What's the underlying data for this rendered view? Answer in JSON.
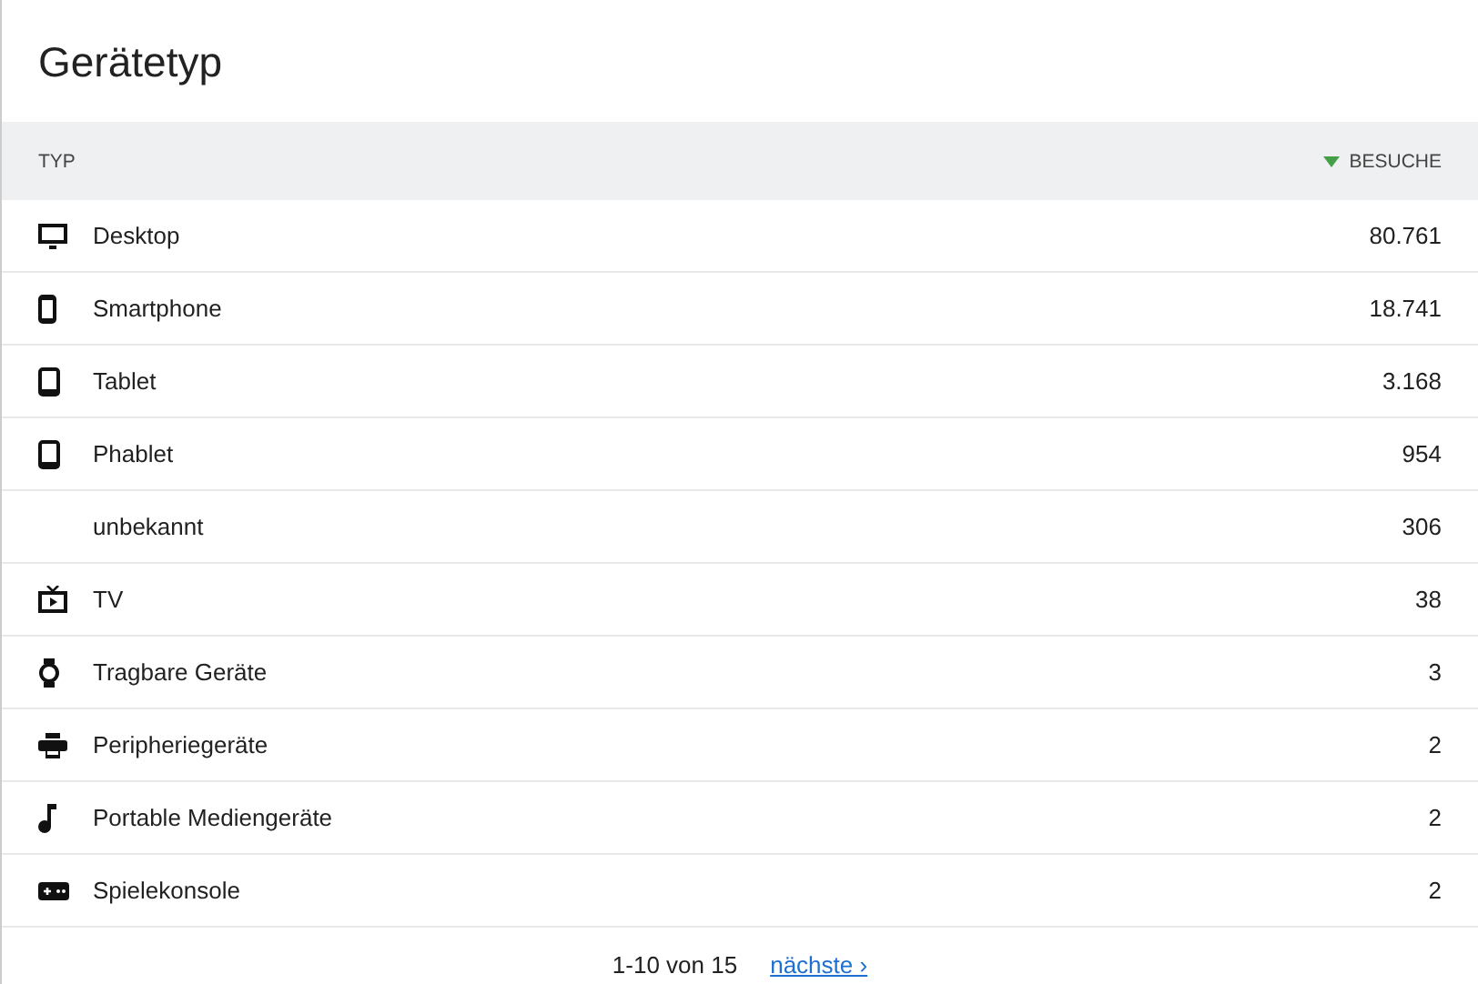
{
  "title": "Gerätetyp",
  "columns": [
    {
      "label": "TYP",
      "sorted": false
    },
    {
      "label": "BESUCHE",
      "sorted": true
    }
  ],
  "rows": [
    {
      "kind": "desktop",
      "label": "Desktop",
      "visits": "80.761"
    },
    {
      "kind": "smartphone",
      "label": "Smartphone",
      "visits": "18.741"
    },
    {
      "kind": "tablet",
      "label": "Tablet",
      "visits": "3.168"
    },
    {
      "kind": "tablet",
      "label": "Phablet",
      "visits": "954"
    },
    {
      "kind": "none",
      "label": "unbekannt",
      "visits": "306"
    },
    {
      "kind": "tv",
      "label": "TV",
      "visits": "38"
    },
    {
      "kind": "watch",
      "label": "Tragbare Geräte",
      "visits": "3"
    },
    {
      "kind": "printer",
      "label": "Peripheriegeräte",
      "visits": "2"
    },
    {
      "kind": "music",
      "label": "Portable Mediengeräte",
      "visits": "2"
    },
    {
      "kind": "gamepad",
      "label": "Spielekonsole",
      "visits": "2"
    }
  ],
  "pagination": {
    "range": "1-10 von 15",
    "next": "nächste ›"
  }
}
